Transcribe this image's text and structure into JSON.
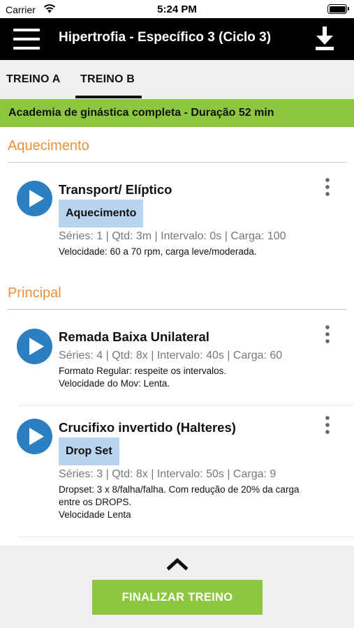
{
  "status_bar": {
    "carrier": "Carrier",
    "time": "5:24 PM"
  },
  "header": {
    "title": "Hipertrofia - Específico 3 (Ciclo 3)"
  },
  "tabs": [
    {
      "label": "TREINO A",
      "selected": false
    },
    {
      "label": "TREINO B",
      "selected": true
    }
  ],
  "banner": {
    "text": "Academia de ginástica completa - Duração 52 min"
  },
  "sections": [
    {
      "title": "Aquecimento",
      "exercises": [
        {
          "name": "Transport/ Elíptico",
          "tag": "Aquecimento",
          "stats": "Séries: 1 | Qtd: 3m | Intervalo: 0s | Carga: 100",
          "notes": [
            "Velocidade: 60 a 70 rpm, carga leve/moderada."
          ]
        }
      ]
    },
    {
      "title": "Principal",
      "exercises": [
        {
          "name": "Remada Baixa Unilateral",
          "stats": "Séries: 4 | Qtd: 8x | Intervalo: 40s | Carga: 60",
          "notes": [
            "Formato Regular: respeite os intervalos.",
            "Velocidade do Mov: Lenta."
          ]
        },
        {
          "name": "Crucifixo invertido (Halteres)",
          "tag": "Drop Set",
          "stats": "Séries: 3 | Qtd: 8x | Intervalo: 50s | Carga: 9",
          "notes": [
            "Dropset: 3 x 8/falha/falha. Com redução de 20% da carga",
            "entre os DROPS.",
            "Velocidade Lenta"
          ]
        }
      ]
    }
  ],
  "footer": {
    "finish_label": "FINALIZAR TREINO"
  },
  "colors": {
    "accent_green": "#8dc63f",
    "section_orange": "#e8913a",
    "play_blue": "#2b7fc3",
    "tag_blue": "#b9d4ef",
    "header_black": "#000000"
  },
  "icons": [
    "wifi-icon",
    "battery-icon",
    "menu-icon",
    "download-icon",
    "play-icon",
    "more-vertical-icon",
    "chevron-up-icon"
  ]
}
